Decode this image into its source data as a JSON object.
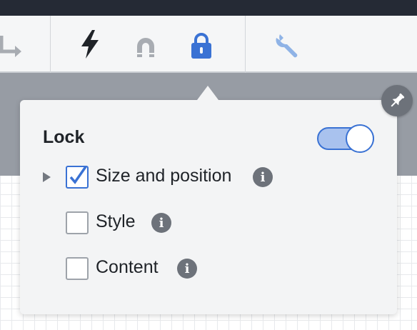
{
  "toolbar": {
    "icons": [
      "connector-elbow-icon",
      "lightning-icon",
      "magnet-icon",
      "lock-icon",
      "wrench-icon"
    ],
    "active_icon": "lock-icon",
    "colors": {
      "active": "#3a72d4",
      "inactive": "#a8acb2",
      "dark": "#1f2328"
    }
  },
  "popover": {
    "title": "Lock",
    "toggle_on": true,
    "pin_icon": "pin-icon",
    "options": [
      {
        "label": "Size and position",
        "checked": true,
        "expandable": true,
        "info_glyph": "i"
      },
      {
        "label": "Style",
        "checked": false,
        "expandable": false,
        "info_glyph": "i"
      },
      {
        "label": "Content",
        "checked": false,
        "expandable": false,
        "info_glyph": "i"
      }
    ]
  }
}
